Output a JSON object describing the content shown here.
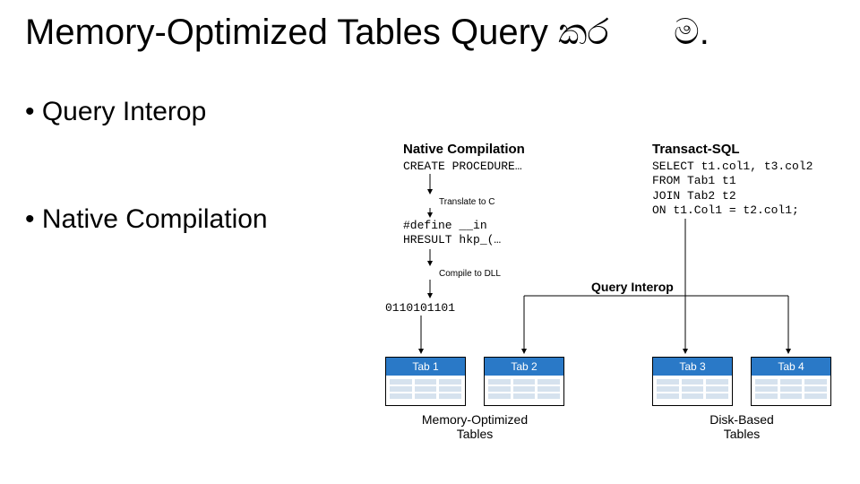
{
  "title": "Memory-Optimized Tables Query කර",
  "title_extra": "ම.",
  "bullets": {
    "b1": "• Query Interop",
    "b2": "• Native Compilation"
  },
  "headings": {
    "native": "Native Compilation",
    "tsql": "Transact-SQL"
  },
  "code": {
    "proc": "CREATE PROCEDURE…",
    "translate": "Translate to C",
    "c": "#define __in\nHRESULT hkp_(…",
    "compile": "Compile to DLL",
    "bin": "0110101101",
    "sql": "SELECT t1.col1, t3.col2\nFROM Tab1 t1\nJOIN Tab2 t2\nON t1.Col1 = t2.col1;"
  },
  "labels": {
    "query_interop": "Query Interop"
  },
  "tables": {
    "t1": "Tab 1",
    "t2": "Tab 2",
    "t3": "Tab 3",
    "t4": "Tab 4"
  },
  "captions": {
    "mem": "Memory-Optimized\nTables",
    "disk": "Disk-Based\nTables"
  }
}
